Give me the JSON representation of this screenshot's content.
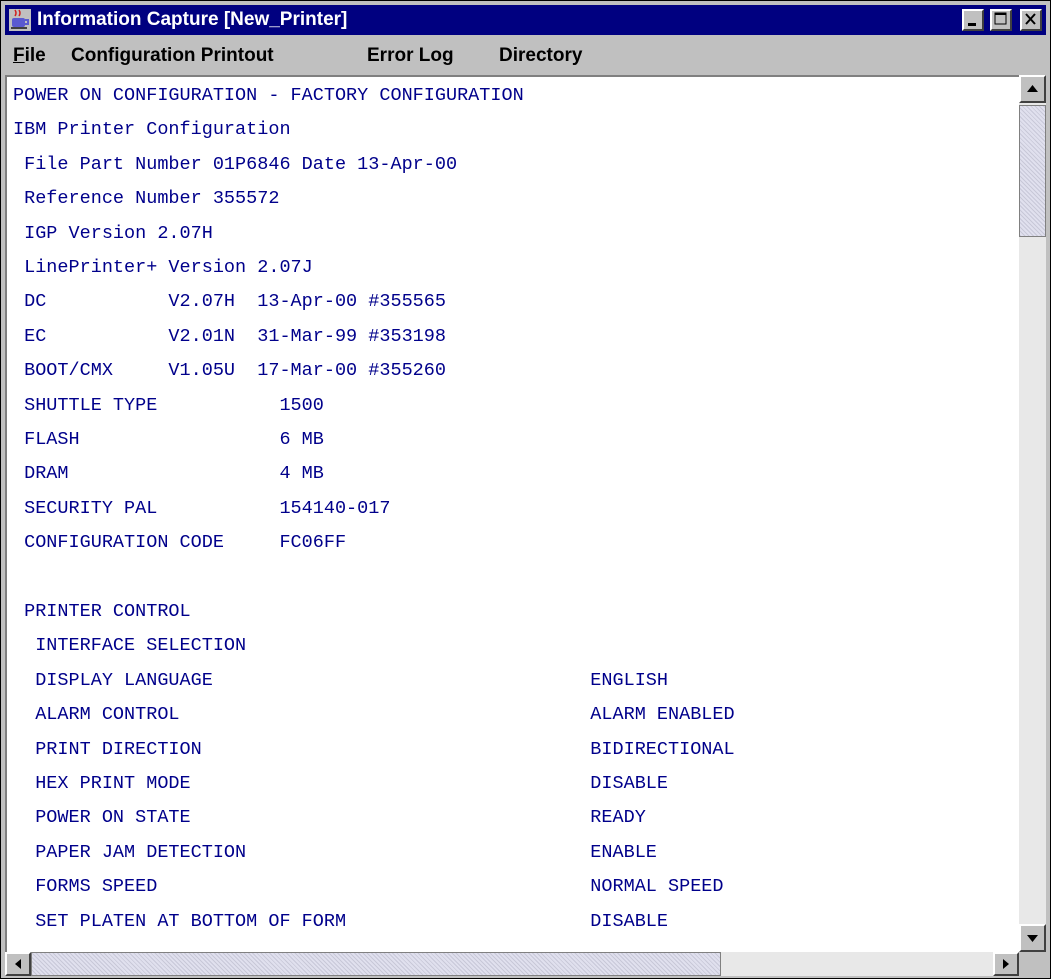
{
  "window": {
    "title": "Information Capture [New_Printer]",
    "icon": "java-cup-icon"
  },
  "menu": [
    {
      "label": "File",
      "mnemonic": "F"
    },
    {
      "label": "Configuration Printout",
      "mnemonic": "C"
    },
    {
      "label": "Error Log",
      "mnemonic": "E"
    },
    {
      "label": "Directory",
      "mnemonic": "D"
    }
  ],
  "content": {
    "lines": [
      "POWER ON CONFIGURATION - FACTORY CONFIGURATION",
      "IBM Printer Configuration",
      " File Part Number 01P6846 Date 13-Apr-00",
      " Reference Number 355572",
      " IGP Version 2.07H",
      " LinePrinter+ Version 2.07J",
      " DC           V2.07H  13-Apr-00 #355565",
      " EC           V2.01N  31-Mar-99 #353198",
      " BOOT/CMX     V1.05U  17-Mar-00 #355260",
      " SHUTTLE TYPE           1500",
      " FLASH                  6 MB",
      " DRAM                   4 MB",
      " SECURITY PAL           154140-017",
      " CONFIGURATION CODE     FC06FF",
      "",
      " PRINTER CONTROL",
      "  INTERFACE SELECTION",
      "  DISPLAY LANGUAGE                                  ENGLISH",
      "  ALARM CONTROL                                     ALARM ENABLED",
      "  PRINT DIRECTION                                   BIDIRECTIONAL",
      "  HEX PRINT MODE                                    DISABLE",
      "  POWER ON STATE                                    READY",
      "  PAPER JAM DETECTION                               ENABLE",
      "  FORMS SPEED                                       NORMAL SPEED",
      "  SET PLATEN AT BOTTOM OF FORM                      DISABLE"
    ]
  },
  "colors": {
    "titlebar": "#000080",
    "text": "#00008b",
    "chrome": "#c0c0c0"
  }
}
